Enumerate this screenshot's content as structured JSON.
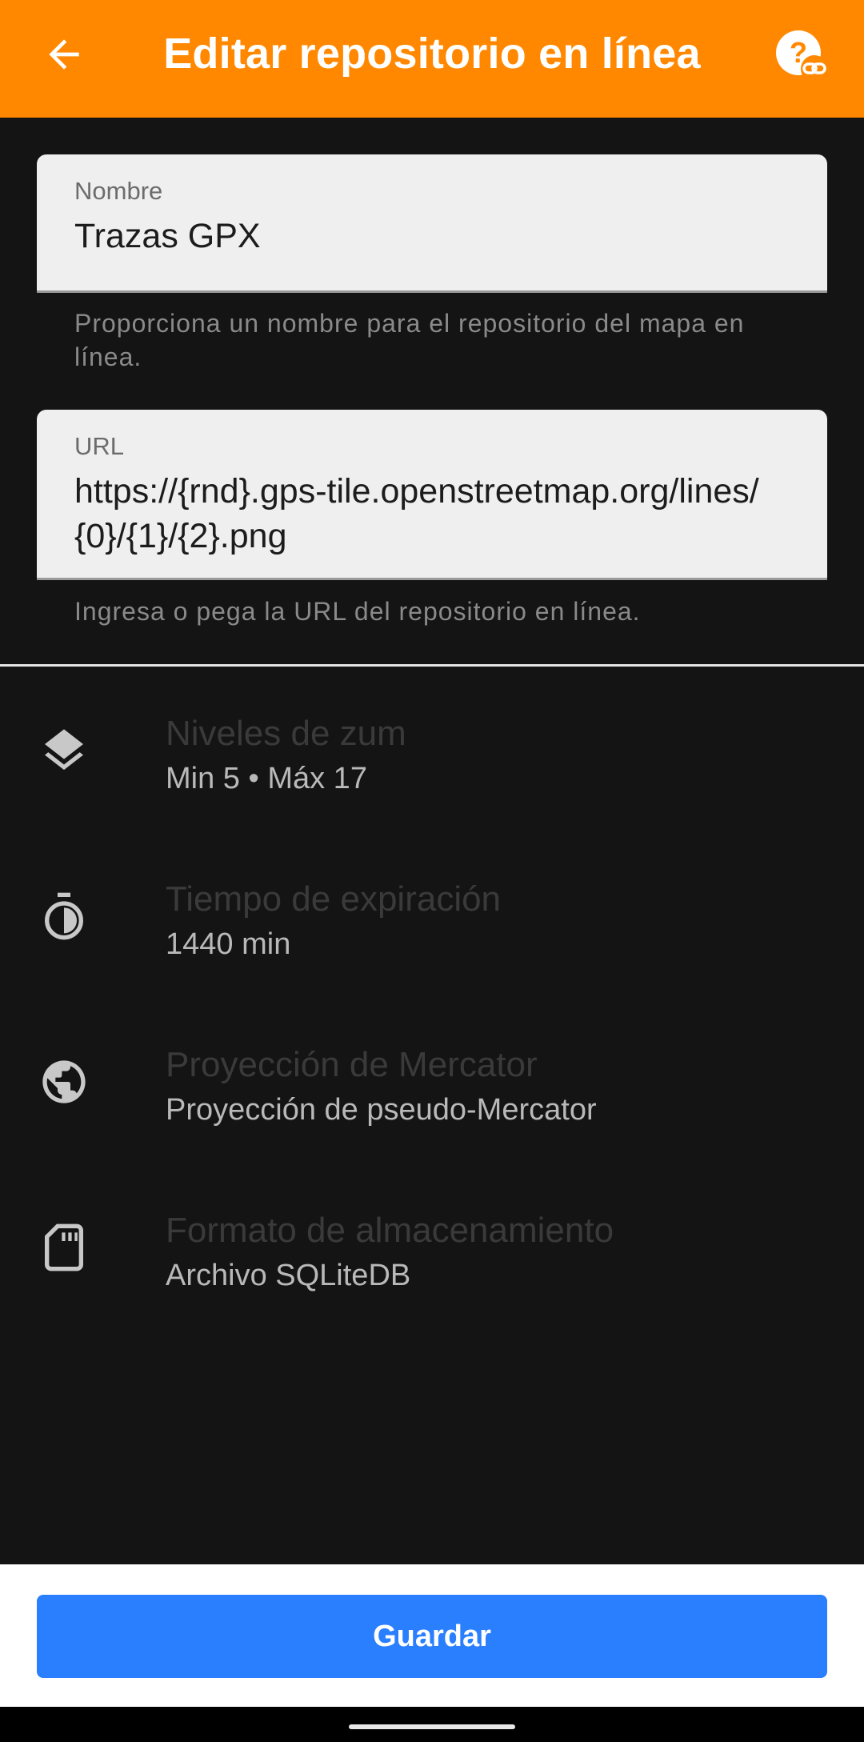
{
  "appbar": {
    "title": "Editar repositorio en línea",
    "back_icon": "arrow-left-icon",
    "help_icon": "help-link-icon"
  },
  "form": {
    "name": {
      "label": "Nombre",
      "value": "Trazas GPX",
      "helper": "Proporciona un nombre para el repositorio del mapa en línea."
    },
    "url": {
      "label": "URL",
      "value": "https://{rnd}.gps-tile.openstreetmap.org/lines/{0}/{1}/{2}.png",
      "helper": "Ingresa o pega la URL del repositorio en línea."
    }
  },
  "settings": [
    {
      "title": "Niveles de zum",
      "value": "Min 5 • Máx 17",
      "icon": "layers-icon"
    },
    {
      "title": "Tiempo de expiración",
      "value": "1440 min",
      "icon": "timer-icon"
    },
    {
      "title": "Proyección de Mercator",
      "value": "Proyección de pseudo-Mercator",
      "icon": "globe-icon"
    },
    {
      "title": "Formato de almacenamiento",
      "value": "Archivo SQLiteDB",
      "icon": "sd-card-icon"
    }
  ],
  "actions": {
    "save_label": "Guardar"
  },
  "colors": {
    "appbar": "#ff8800",
    "background": "#141414",
    "primary_button": "#2a7fff"
  }
}
